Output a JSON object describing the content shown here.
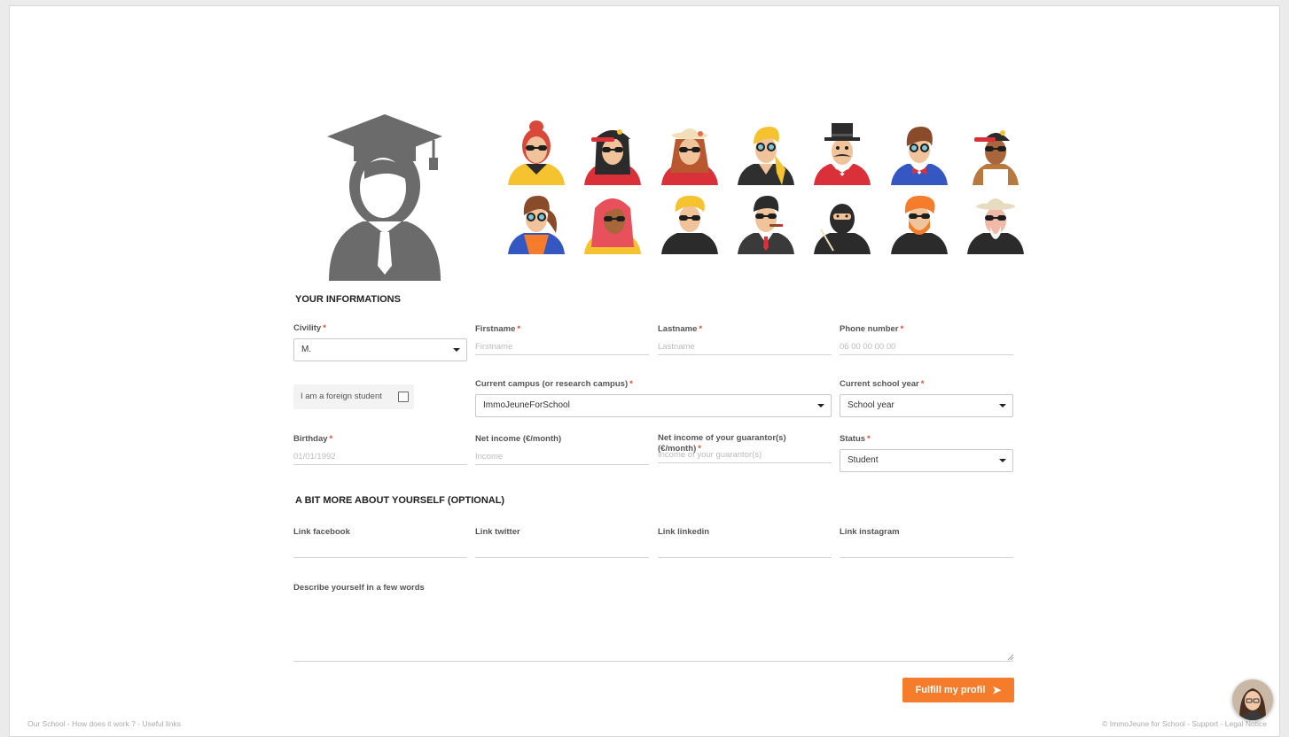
{
  "sections": {
    "your_informations": "YOUR INFORMATIONS",
    "more_about": "A BIT MORE ABOUT YOURSELF (OPTIONAL)"
  },
  "required_mark": "*",
  "fields": {
    "civility": {
      "label": "Civility",
      "value": "M."
    },
    "firstname": {
      "label": "Firstname",
      "placeholder": "Firstname"
    },
    "lastname": {
      "label": "Lastname",
      "placeholder": "Lastname"
    },
    "phone": {
      "label": "Phone number",
      "placeholder": "06 00 00 00 00"
    },
    "foreign_student": {
      "label": "I am a foreign student",
      "checked": false
    },
    "campus": {
      "label": "Current campus (or research campus)",
      "value": "ImmoJeuneForSchool"
    },
    "school_year": {
      "label": "Current school year",
      "value": "School year"
    },
    "birthday": {
      "label": "Birthday",
      "placeholder": "01/01/1992"
    },
    "net_income": {
      "label": "Net income (€/month)",
      "placeholder": "Income"
    },
    "guarantor_income": {
      "label": "Net income of your guarantor(s) (€/month)",
      "placeholder": "Income of your guarantor(s)"
    },
    "status": {
      "label": "Status",
      "value": "Student"
    },
    "facebook": {
      "label": "Link facebook"
    },
    "twitter": {
      "label": "Link twitter"
    },
    "linkedin": {
      "label": "Link linkedin"
    },
    "instagram": {
      "label": "Link instagram"
    },
    "describe": {
      "label": "Describe yourself in a few words"
    }
  },
  "submit_label": "Fulfill my profil",
  "footer": {
    "links": [
      "Our School",
      "How does it work ?",
      "Useful links"
    ],
    "separator": " - ",
    "copyright": "© ImmoJeune for School",
    "support": "Support",
    "legal": "Legal Notice"
  },
  "icons": {
    "main_avatar": "graduate-avatar-icon",
    "avatars": [
      "avatar-red-hair-woman",
      "avatar-cap-woman",
      "avatar-hat-woman",
      "avatar-blonde-man",
      "avatar-tophat-man",
      "avatar-bowtie-man",
      "avatar-cap-man",
      "avatar-ponytail-woman",
      "avatar-pink-hair-woman",
      "avatar-blonde-glasses-man",
      "avatar-cigar-man",
      "avatar-ninja",
      "avatar-ginger-beard-man",
      "avatar-explorer-man"
    ]
  },
  "colors": {
    "accent": "#f47c2a",
    "required": "#e04a2f",
    "main_avatar": "#6b6b6b"
  }
}
